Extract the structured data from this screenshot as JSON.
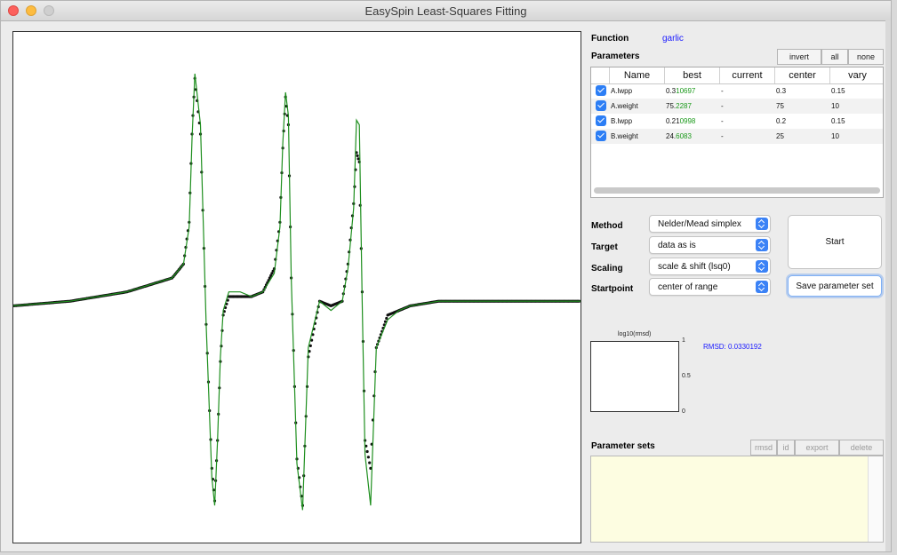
{
  "window": {
    "title": "EasySpin Least-Squares Fitting"
  },
  "function": {
    "label": "Function",
    "value": "garlic"
  },
  "parameters": {
    "label": "Parameters",
    "buttons": {
      "invert": "invert",
      "all": "all",
      "none": "none"
    },
    "columns": [
      "Name",
      "best",
      "current",
      "center",
      "vary"
    ],
    "rows": [
      {
        "name": "A.lwpp",
        "best_prefix": "0.3",
        "best_suffix": "10697",
        "current": "-",
        "center": "0.3",
        "vary": "0.15"
      },
      {
        "name": "A.weight",
        "best_prefix": "75.",
        "best_suffix": "2287",
        "current": "-",
        "center": "75",
        "vary": "10"
      },
      {
        "name": "B.lwpp",
        "best_prefix": "0.21",
        "best_suffix": "0998",
        "current": "-",
        "center": "0.2",
        "vary": "0.15"
      },
      {
        "name": "B.weight",
        "best_prefix": "24.",
        "best_suffix": "6083",
        "current": "-",
        "center": "25",
        "vary": "10"
      }
    ]
  },
  "settings": {
    "method": {
      "label": "Method",
      "value": "Nelder/Mead simplex"
    },
    "target": {
      "label": "Target",
      "value": "data as is"
    },
    "scaling": {
      "label": "Scaling",
      "value": "scale & shift (lsq0)"
    },
    "startpoint": {
      "label": "Startpoint",
      "value": "center of range"
    }
  },
  "buttons": {
    "start": "Start",
    "save": "Save parameter set"
  },
  "rmsd": {
    "plot_title": "log10(rmsd)",
    "readout": "RMSD: 0.0330192",
    "ticks": [
      "1",
      "0.5",
      "0"
    ]
  },
  "parameter_sets": {
    "label": "Parameter sets",
    "buttons": {
      "rmsd": "rmsd",
      "id": "id",
      "export": "export",
      "delete": "delete"
    }
  },
  "colors": {
    "fit_line": "#1f8f1f",
    "data_points": "#111111",
    "accent": "#2c7ef5",
    "link_blue": "#1a1aff",
    "best_digits": "#1c9a1c"
  },
  "chart_data": {
    "type": "line",
    "title": "",
    "xlabel": "",
    "ylabel": "",
    "grid": false,
    "legend": "none",
    "xlim": [
      0,
      1
    ],
    "ylim": [
      -0.52,
      0.58
    ],
    "series": [
      {
        "role": "fit",
        "style": "green line",
        "x": [
          0.0,
          0.1,
          0.2,
          0.28,
          0.3,
          0.31,
          0.315,
          0.32,
          0.33,
          0.34,
          0.35,
          0.355,
          0.36,
          0.365,
          0.37,
          0.38,
          0.4,
          0.42,
          0.44,
          0.46,
          0.47,
          0.475,
          0.48,
          0.485,
          0.49,
          0.5,
          0.51,
          0.52,
          0.54,
          0.56,
          0.58,
          0.59,
          0.6,
          0.605,
          0.61,
          0.615,
          0.62,
          0.63,
          0.64,
          0.66,
          0.68,
          0.7,
          0.75,
          0.8,
          0.85,
          0.9,
          0.95,
          1.0
        ],
        "y": [
          -0.01,
          0.0,
          0.02,
          0.05,
          0.08,
          0.16,
          0.35,
          0.49,
          0.38,
          -0.05,
          -0.38,
          -0.44,
          -0.3,
          -0.12,
          -0.02,
          0.02,
          0.02,
          0.01,
          0.02,
          0.06,
          0.16,
          0.34,
          0.45,
          0.4,
          0.05,
          -0.35,
          -0.45,
          -0.1,
          0.0,
          -0.02,
          0.0,
          0.07,
          0.2,
          0.39,
          0.38,
          0.0,
          -0.33,
          -0.44,
          -0.1,
          -0.04,
          -0.02,
          -0.01,
          0.0,
          0.0,
          0.0,
          0.0,
          0.0,
          0.0
        ]
      },
      {
        "role": "data",
        "style": "black dotted markers",
        "x": [
          0.0,
          0.1,
          0.2,
          0.28,
          0.3,
          0.31,
          0.315,
          0.32,
          0.33,
          0.34,
          0.35,
          0.355,
          0.36,
          0.365,
          0.37,
          0.38,
          0.4,
          0.42,
          0.44,
          0.46,
          0.47,
          0.475,
          0.48,
          0.485,
          0.49,
          0.5,
          0.51,
          0.52,
          0.54,
          0.56,
          0.58,
          0.59,
          0.6,
          0.605,
          0.61,
          0.615,
          0.62,
          0.63,
          0.64,
          0.66,
          0.68,
          0.7,
          0.75,
          0.8,
          0.85,
          0.9,
          0.95,
          1.0
        ],
        "y": [
          -0.01,
          0.0,
          0.02,
          0.05,
          0.08,
          0.17,
          0.36,
          0.48,
          0.36,
          -0.05,
          -0.36,
          -0.43,
          -0.3,
          -0.13,
          -0.03,
          0.01,
          0.01,
          0.01,
          0.02,
          0.07,
          0.17,
          0.33,
          0.44,
          0.38,
          0.05,
          -0.34,
          -0.44,
          -0.12,
          0.0,
          -0.01,
          0.0,
          0.08,
          0.21,
          0.32,
          0.3,
          0.02,
          -0.3,
          -0.36,
          -0.1,
          -0.03,
          -0.02,
          -0.01,
          0.0,
          0.0,
          0.0,
          0.0,
          0.0,
          0.0
        ]
      }
    ]
  }
}
